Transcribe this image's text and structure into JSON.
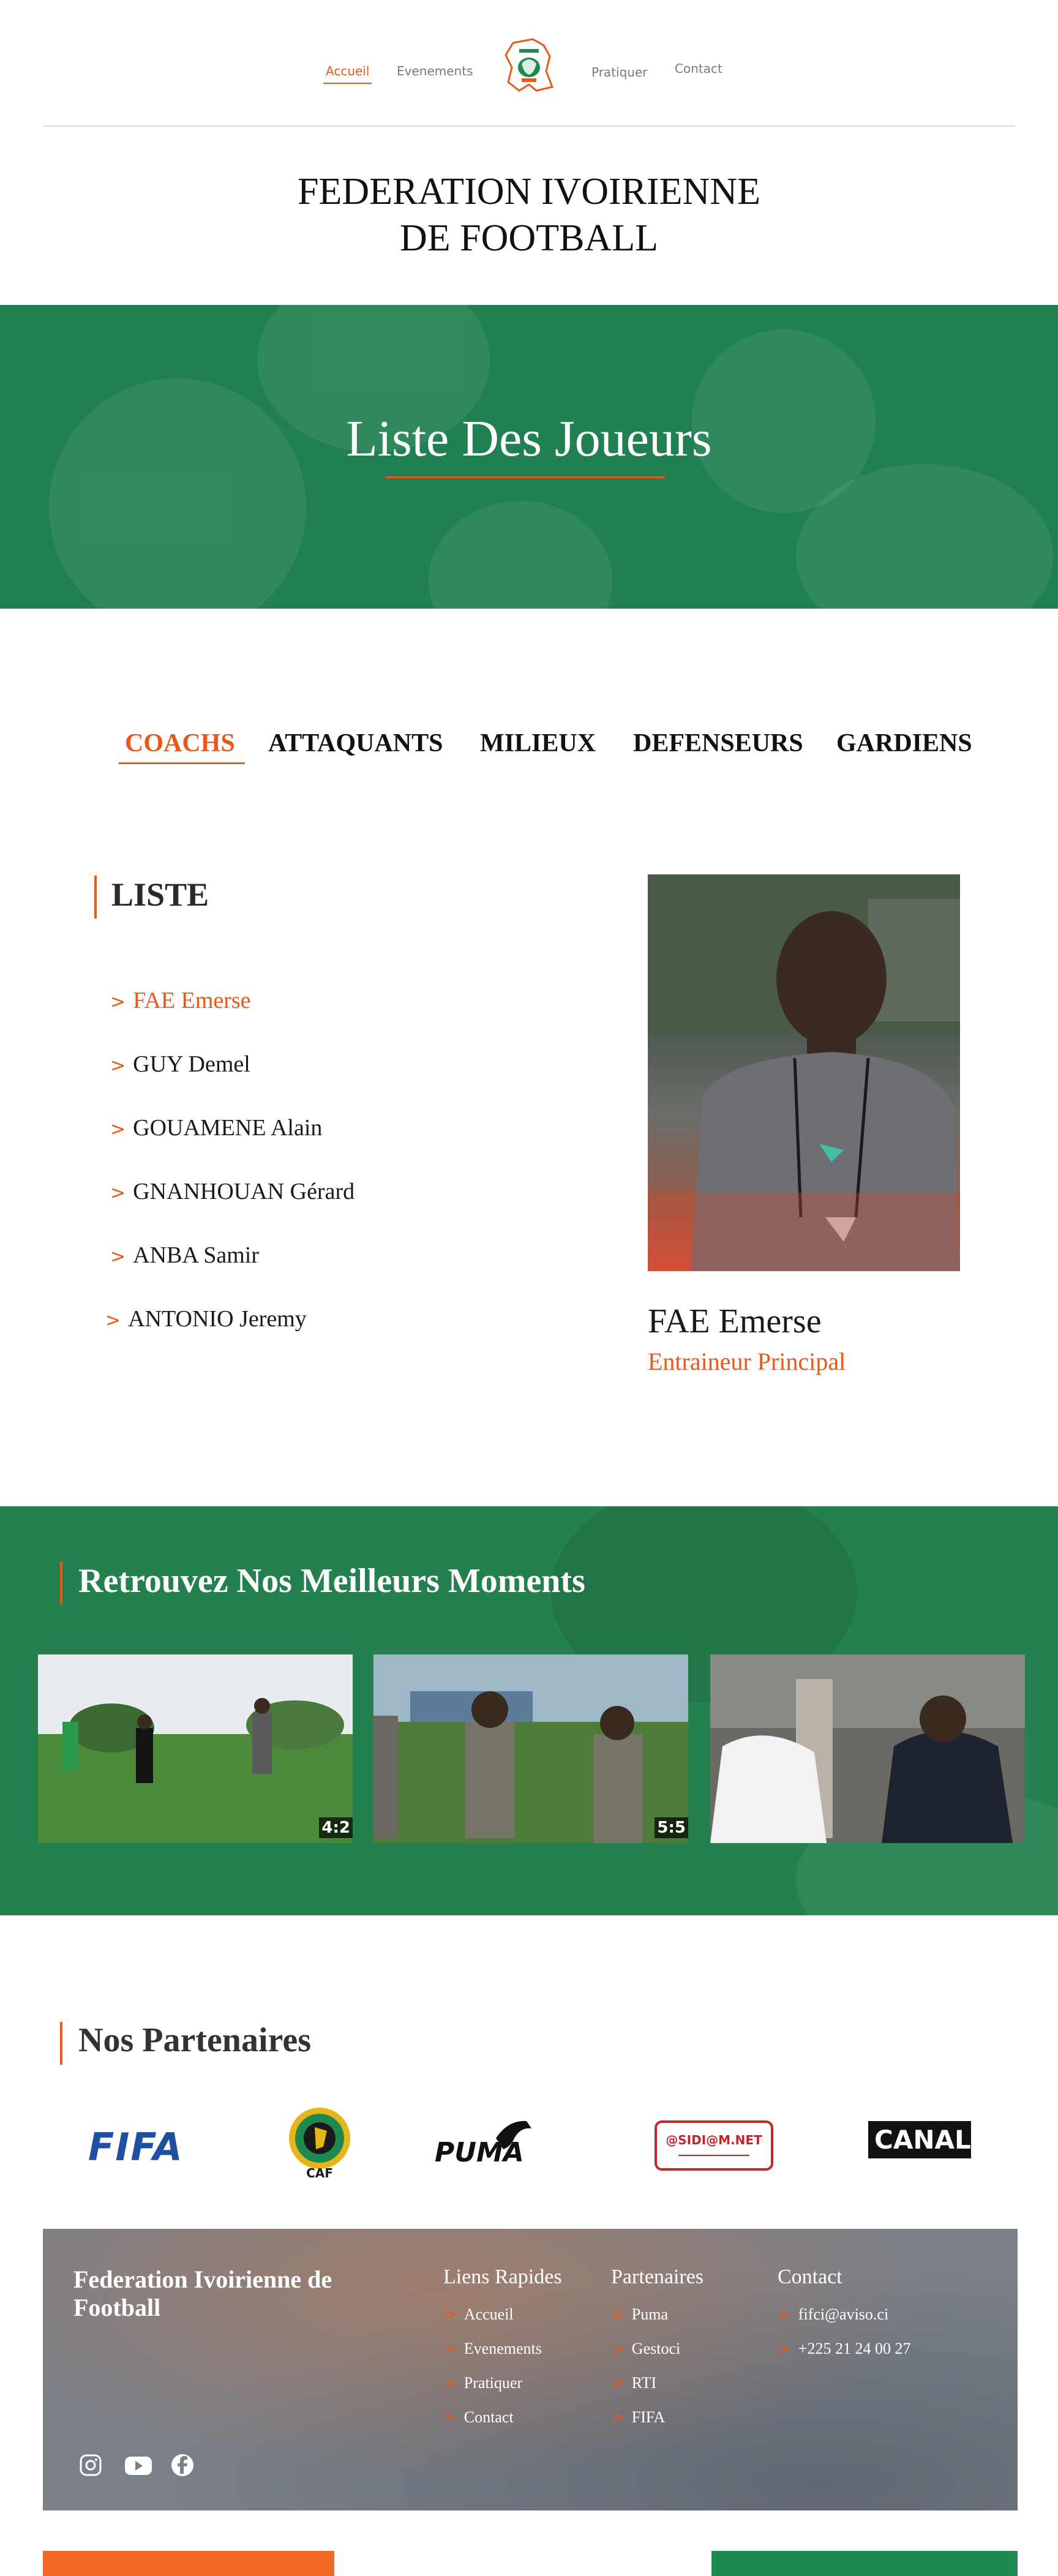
{
  "nav": {
    "items": [
      "Accueil",
      "Evenements",
      "Pratiquer",
      "Contact"
    ],
    "active": "Accueil",
    "logo_icon": "fif-elephant-logo"
  },
  "header": {
    "line1": "FEDERATION IVOIRIENNE",
    "line2": "DE FOOTBALL"
  },
  "hero": {
    "title": "Liste Des Joueurs",
    "background": "#218051"
  },
  "tabs": [
    "COACHS",
    "ATTAQUANTS",
    "MILIEUX",
    "DEFENSEURS",
    "GARDIENS"
  ],
  "list": {
    "title": "LISTE",
    "items": [
      "FAE Emerse",
      "GUY Demel",
      "GOUAMENE Alain",
      "GNANHOUAN Gérard",
      "ANBA Samir",
      "ANTONIO Jeremy"
    ],
    "selected": "FAE Emerse"
  },
  "coach": {
    "name": "FAE Emerse",
    "role": "Entraineur Principal"
  },
  "moments": {
    "title": "Retrouvez Nos Meilleurs Moments",
    "videos": [
      {
        "duration": "4:2"
      },
      {
        "duration": "5:5"
      },
      {
        "duration": ""
      }
    ]
  },
  "partners": {
    "title": "Nos Partenaires",
    "logos": {
      "fifa": "FIFA",
      "caf": "CAF",
      "puma": "PUMA",
      "sidiam": "@SIDI@M.NET",
      "canal": "CANAL+"
    }
  },
  "footer": {
    "brand": "Federation Ivoirienne de Football",
    "quick_links": {
      "title": "Liens Rapides",
      "items": [
        "Accueil",
        "Evenements",
        "Pratiquer",
        "Contact"
      ]
    },
    "partners": {
      "title": "Partenaires",
      "items": [
        "Puma",
        "Gestoci",
        "RTI",
        "FIFA"
      ]
    },
    "contact": {
      "title": "Contact",
      "items": [
        "fifci@aviso.ci",
        "+225 21 24 00 27"
      ]
    },
    "social": [
      "instagram-icon",
      "youtube-icon",
      "facebook-icon"
    ]
  },
  "colors": {
    "accent": "#e8581b",
    "green": "#218051",
    "footer_orange": "#f26722",
    "footer_green": "#1f8a4f"
  }
}
